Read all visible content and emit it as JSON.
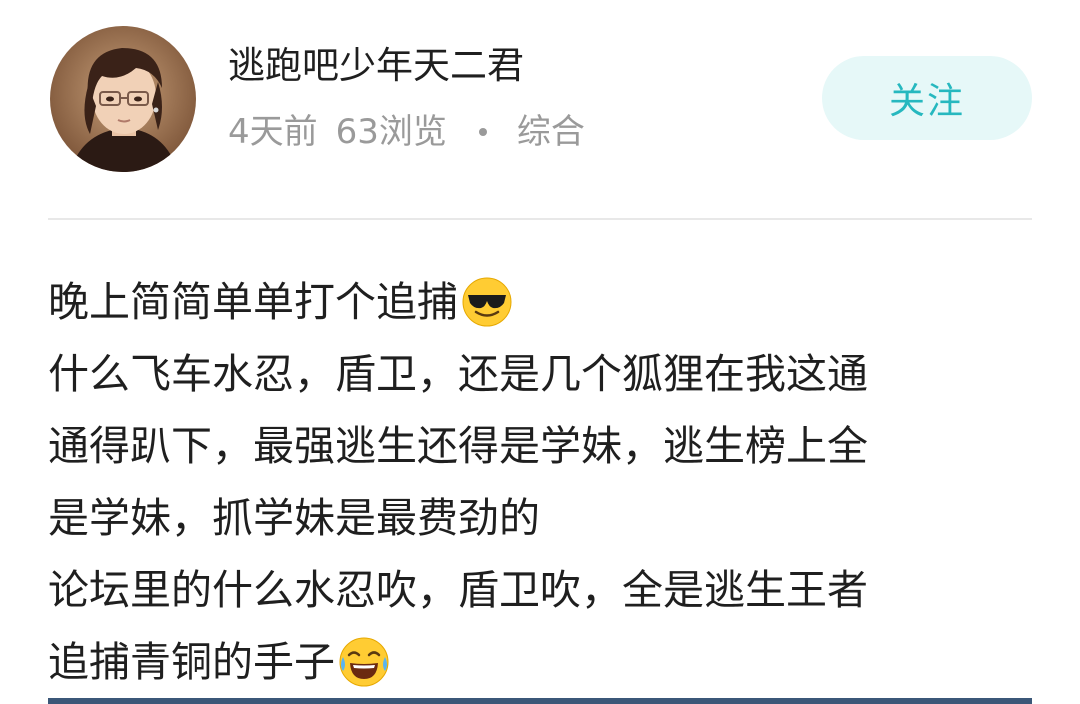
{
  "post": {
    "author": {
      "username": "逃跑吧少年天二君"
    },
    "meta": {
      "time": "4天前",
      "views": "63浏览",
      "separator": "·",
      "category": "综合"
    },
    "follow_label": "关注",
    "content_lines": [
      {
        "text": "晚上简简单单打个追捕",
        "emoji": "sunglasses-emoji"
      },
      {
        "text": "什么飞车水忍，盾卫，还是几个狐狸在我这通"
      },
      {
        "text": "通得趴下，最强逃生还得是学妹，逃生榜上全"
      },
      {
        "text": "是学妹，抓学妹是最费劲的"
      },
      {
        "text": "论坛里的什么水忍吹，盾卫吹，全是逃生王者"
      },
      {
        "text": "追捕青铜的手子",
        "emoji": "tears-of-joy-emoji"
      }
    ]
  },
  "colors": {
    "follow_bg": "#e6f8f8",
    "follow_text": "#26b8bf",
    "meta_text": "#9a9a9a",
    "divider": "#e8e8e8",
    "bottom_bar": "#3b5778"
  }
}
